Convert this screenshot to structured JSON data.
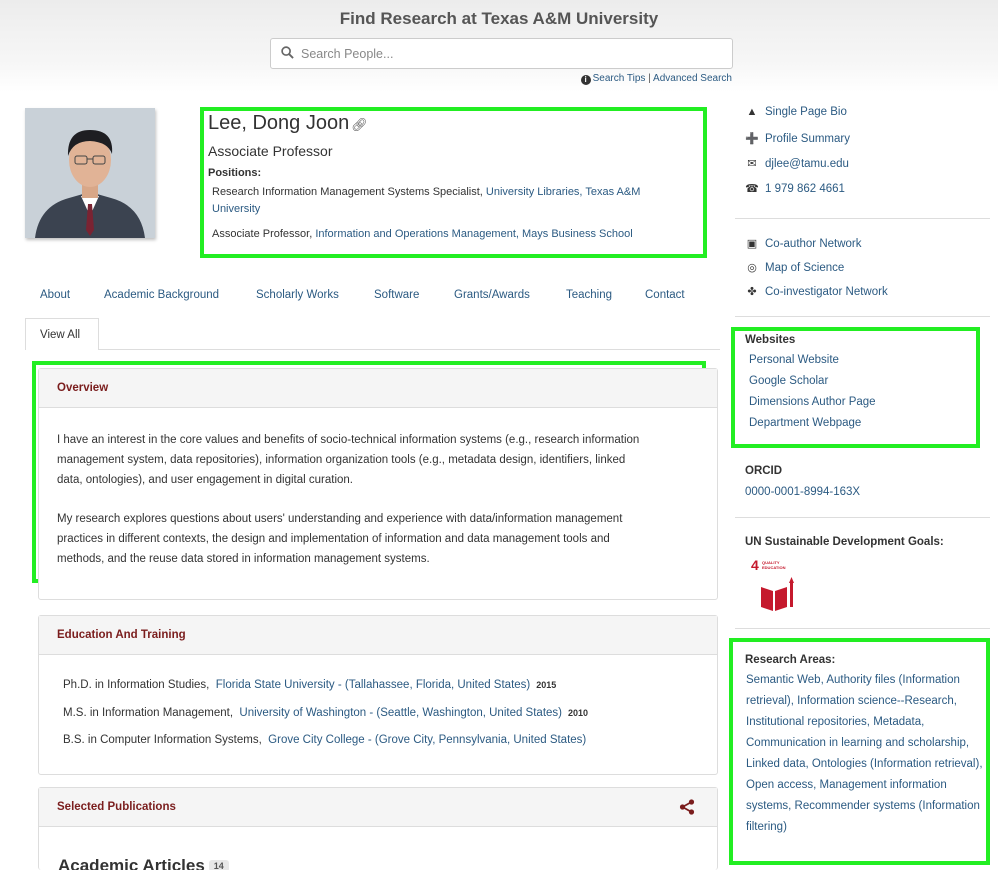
{
  "header": {
    "title": "Find Research at Texas A&M University",
    "search_placeholder": "Search People...",
    "search_tips": "Search Tips",
    "separator": "|",
    "advanced_search": "Advanced Search"
  },
  "profile": {
    "name": "Lee, Dong Joon",
    "rank": "Associate Professor",
    "positions_label": "Positions:",
    "positions": [
      {
        "title": "Research Information Management Systems Specialist, ",
        "org_line1": "University Libraries, Texas A&M",
        "org_line2": "University"
      },
      {
        "title": "Associate Professor, ",
        "org": "Information and Operations Management, Mays Business School"
      }
    ]
  },
  "tabs": [
    "About",
    "Academic Background",
    "Scholarly Works",
    "Software",
    "Grants/Awards",
    "Teaching",
    "Contact"
  ],
  "active_tab": "View All",
  "overview": {
    "heading": "Overview",
    "p1_lines": [
      "I have an interest in the core values and benefits of socio-technical information systems (e.g., research information",
      "management system, data repositories), information organization tools (e.g., metadata design, identifiers, linked",
      "data, ontologies), and user engagement in digital curation."
    ],
    "p2_lines": [
      "My research explores questions about users' understanding and experience with data/information management",
      "practices in different contexts, the design and implementation of information and data management tools and",
      "methods, and the reuse data stored in information management systems."
    ]
  },
  "education": {
    "heading": "Education And Training",
    "items": [
      {
        "degree": "Ph.D. in Information Studies,",
        "school": "Florida State University - (Tallahassee, Florida, United States)",
        "year": "2015"
      },
      {
        "degree": "M.S. in Information Management,",
        "school": "University of Washington - (Seattle, Washington, United States)",
        "year": "2010"
      },
      {
        "degree": "B.S. in Computer Information Systems,",
        "school": "Grove City College - (Grove City, Pennsylvania, United States)",
        "year": ""
      }
    ]
  },
  "publications": {
    "heading": "Selected Publications",
    "articles_title": "Academic Articles",
    "articles_count": "14"
  },
  "sidebar": {
    "links": [
      "Single Page Bio",
      "Profile Summary",
      "djlee@tamu.edu",
      "1 979 862 4661"
    ],
    "visualizations": [
      "Co-author Network",
      "Map of Science",
      "Co-investigator Network"
    ],
    "websites_heading": "Websites",
    "websites": [
      "Personal Website",
      "Google Scholar",
      "Dimensions Author Page",
      "Department Webpage"
    ],
    "orcid_heading": "ORCID",
    "orcid": "0000-0001-8994-163X",
    "sdg_heading": "UN Sustainable Development Goals:",
    "sdg_badge_number": "4",
    "sdg_badge_text": "QUALITY EDUCATION",
    "research_heading": "Research Areas:",
    "research_areas": "Semantic Web, Authority files (Information retrieval), Information science--Research, Institutional repositories, Metadata, Communication in learning and scholarship, Linked data, Ontologies (Information retrieval), Open access, Management information systems, Recommender systems (Information filtering)"
  },
  "colors": {
    "highlight": "#22ee22",
    "link": "#2b5a82",
    "panel_heading": "#7a1d1d",
    "sdg_red": "#c5192d"
  }
}
